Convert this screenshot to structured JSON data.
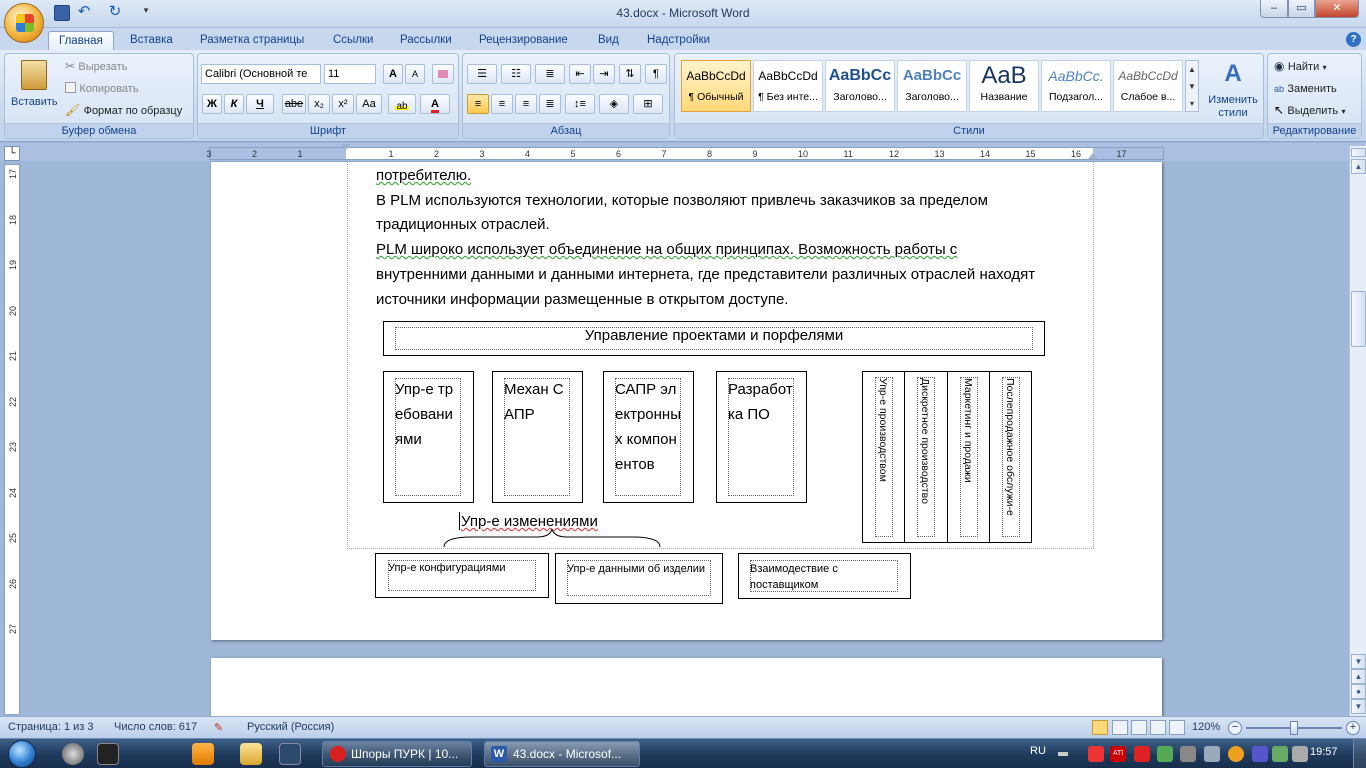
{
  "app": {
    "window_title": "43.docx - Microsoft Word",
    "window_buttons": [
      "–",
      "▭",
      "✕"
    ]
  },
  "ribbon_tabs": [
    "Главная",
    "Вставка",
    "Разметка страницы",
    "Ссылки",
    "Рассылки",
    "Рецензирование",
    "Вид",
    "Надстройки"
  ],
  "clipboard": {
    "paste": "Вставить",
    "cut": "Вырезать",
    "copy": "Копировать",
    "format_painter": "Формат по образцу",
    "label": "Буфер обмена"
  },
  "font": {
    "name": "Calibri (Основной те",
    "size": "11",
    "label": "Шрифт",
    "bold": "Ж",
    "italic": "К",
    "underline": "Ч",
    "strike": "abe",
    "subscript": "x₂",
    "superscript": "x²",
    "case": "Aa",
    "grow": "A",
    "shrink": "A"
  },
  "paragraph": {
    "label": "Абзац"
  },
  "styles": {
    "label": "Стили",
    "items": [
      {
        "preview": "AaBbCcDd",
        "name": "¶ Обычный"
      },
      {
        "preview": "AaBbCcDd",
        "name": "¶ Без инте..."
      },
      {
        "preview": "AaBbCc",
        "name": "Заголово..."
      },
      {
        "preview": "AaBbCc",
        "name": "Заголово..."
      },
      {
        "preview": "AaB",
        "name": "Название"
      },
      {
        "preview": "AaBbCc.",
        "name": "Подзагол..."
      },
      {
        "preview": "AaBbCcDd",
        "name": "Слабое в..."
      }
    ],
    "change": "Изменить стили"
  },
  "editing": {
    "find": "Найти",
    "replace": "Заменить",
    "select": "Выделить",
    "label": "Редактирование"
  },
  "ruler": {
    "h_labels": [
      "3",
      "2",
      "1",
      "1",
      "2",
      "3",
      "4",
      "5",
      "6",
      "7",
      "8",
      "9",
      "10",
      "11",
      "12",
      "13",
      "14",
      "15",
      "16",
      "17"
    ],
    "v_labels": [
      "17",
      "18",
      "19",
      "20",
      "21",
      "22",
      "23",
      "24",
      "25",
      "26",
      "27"
    ]
  },
  "document": {
    "lines": [
      "потребителю.",
      "В PLM  используются технологии, которые позволяют привлечь заказчиков за пределом",
      "традиционных отраслей.",
      "PLM широко использует объединение на общих принципах. Возможность работы с",
      "внутренними данными и данными интернета, где представители различных отраслей находят",
      "источники информации размещенные в открытом доступе."
    ],
    "header_box": "Управление проектами и порфелями",
    "boxes": [
      "Упр-е требованиями",
      "Механ САПР",
      "САПР электронных компонентов",
      "Разработка ПО"
    ],
    "vertical_boxes": [
      "Упр-е производством",
      "Дискретное производство",
      "Маркетинг и продажи",
      "Послепродажное обслужи-е"
    ],
    "change_label": "Упр-е изменениями",
    "bottom_boxes": [
      "Упр-е конфигурациями",
      "Упр-е данными об изделии",
      "Взаимодествие с поставщиком"
    ]
  },
  "status": {
    "page": "Страница: 1 из 3",
    "words": "Число слов: 617",
    "language": "Русский (Россия)",
    "zoom": "120%"
  },
  "taskbar": {
    "tasks": [
      "Шпоры ПУРК | 10...",
      "43.docx - Microsof..."
    ],
    "lang": "RU",
    "time": "19:57"
  }
}
